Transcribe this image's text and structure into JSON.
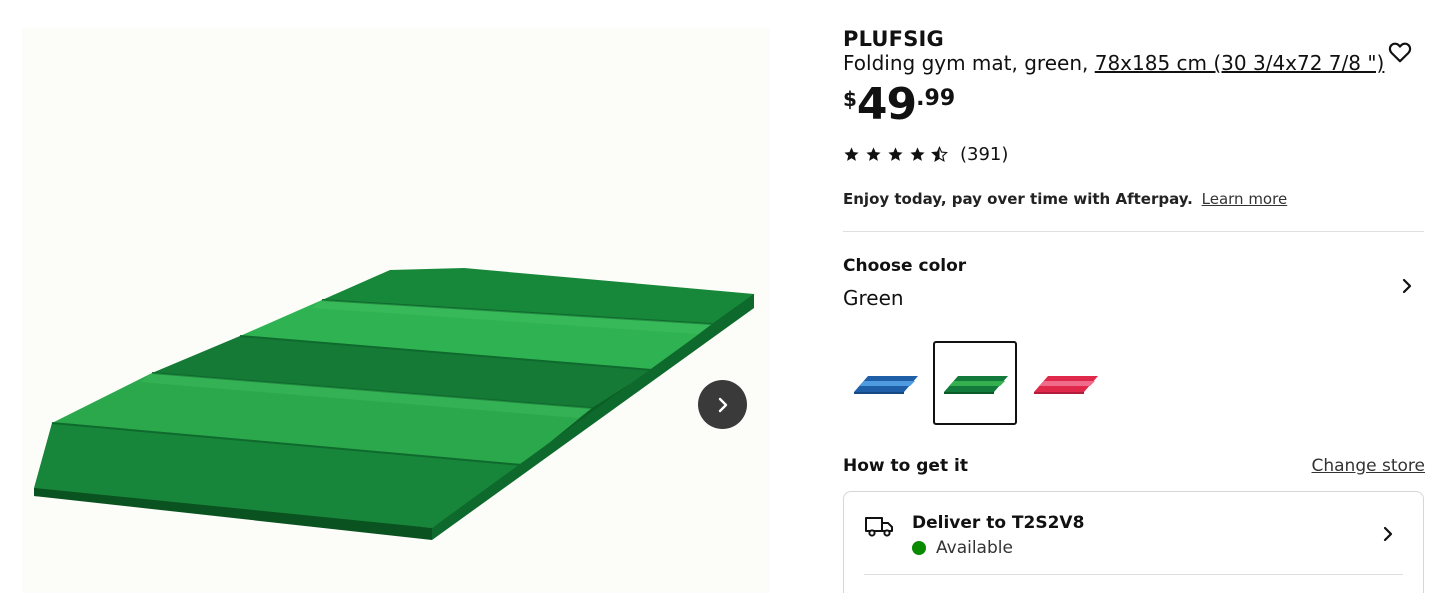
{
  "product": {
    "name": "PLUFSIG",
    "description_prefix": "Folding gym mat, green, ",
    "measurements": "78x185 cm (30 3/4x72 7/8 \")"
  },
  "price": {
    "currency": "$",
    "whole": "49",
    "cents": ".99"
  },
  "rating": {
    "stars": 4.5,
    "count_label": "(391)"
  },
  "afterpay": {
    "message": "Enjoy today, pay over time with Afterpay.",
    "link": "Learn more"
  },
  "color": {
    "title": "Choose color",
    "selected": "Green",
    "options": [
      {
        "name": "Blue",
        "colors": [
          "#1e5fa8",
          "#4f9be0"
        ]
      },
      {
        "name": "Green",
        "colors": [
          "#127a3a",
          "#35b04f"
        ],
        "selected": true
      },
      {
        "name": "Pink",
        "colors": [
          "#e0284b",
          "#f06a8a"
        ]
      }
    ]
  },
  "delivery": {
    "section_title": "How to get it",
    "change_store": "Change store",
    "deliver_to": "Deliver to T2S2V8",
    "status": "Available",
    "status_color": "#0a8a00"
  },
  "icons": {
    "favorite": "heart-icon",
    "next_image": "chevron-right-icon",
    "delivery": "truck-icon"
  }
}
